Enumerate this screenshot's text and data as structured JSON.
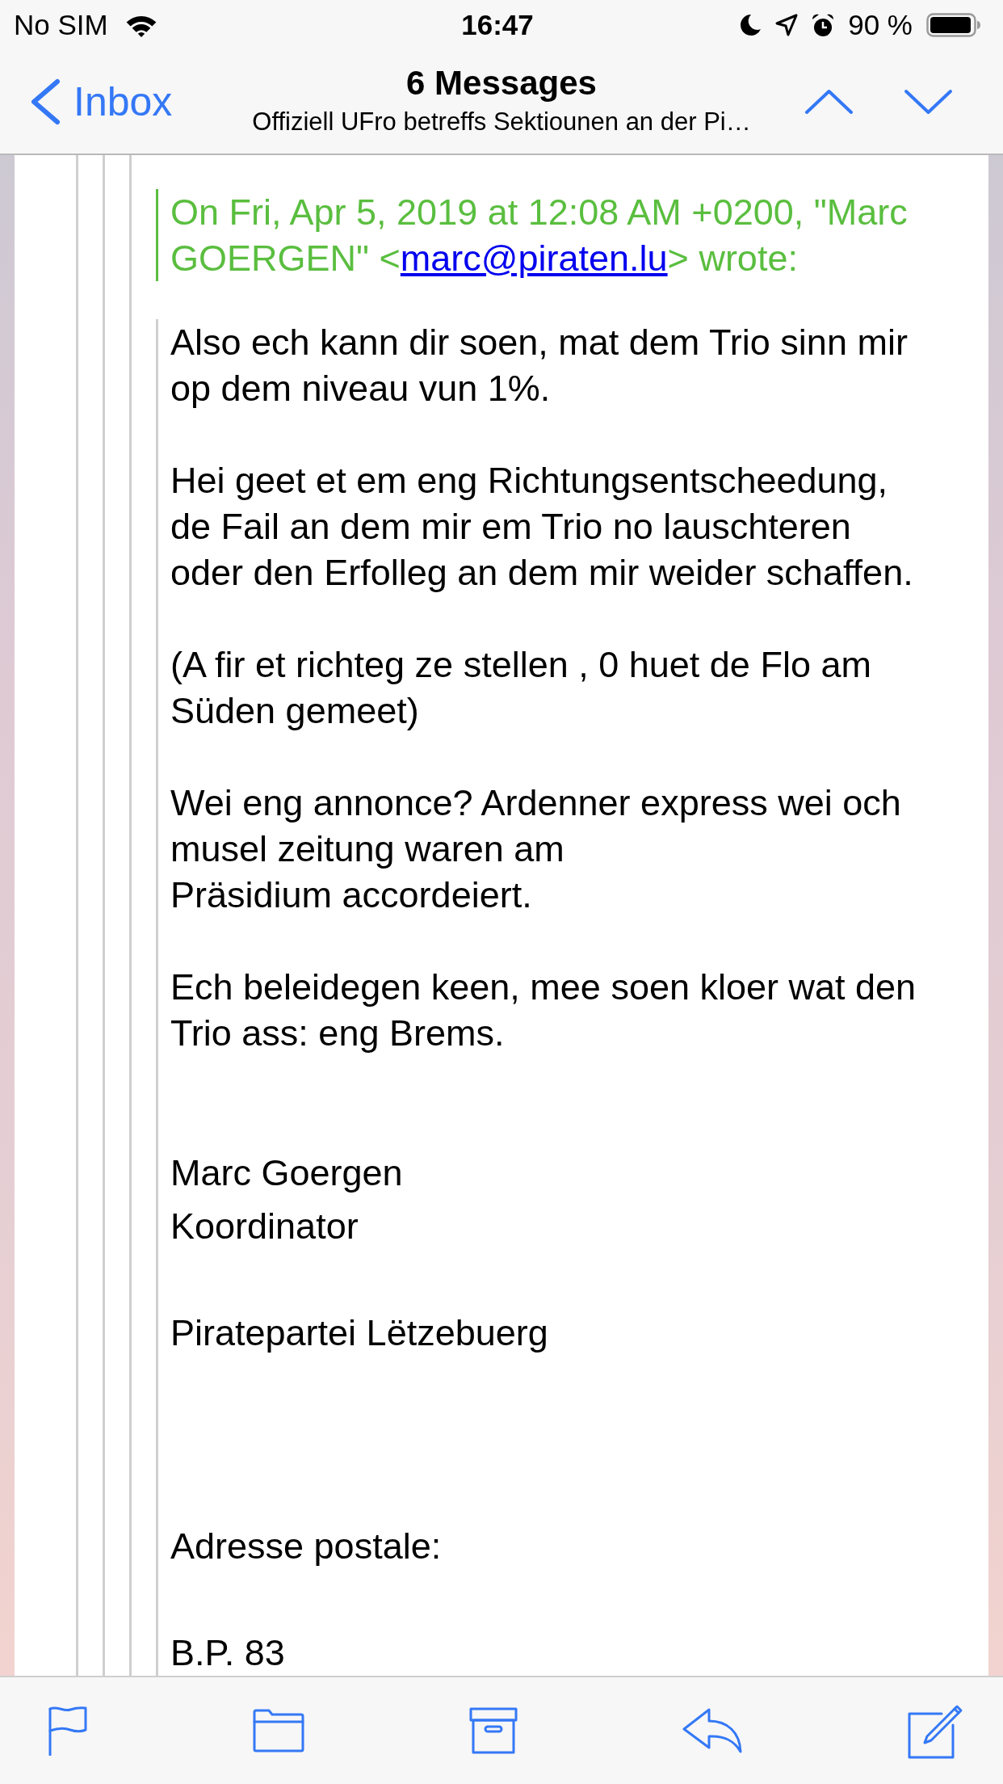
{
  "status_bar": {
    "carrier": "No SIM",
    "time": "16:47",
    "battery_percent": "90 %"
  },
  "nav_bar": {
    "back_label": "Inbox",
    "title": "6 Messages",
    "subtitle": "Offiziell UFro betreffs Sektiounen an der Pi…"
  },
  "message": {
    "attribution": {
      "before": "On Fri, Apr 5, 2019 at 12:08 AM +0200, \"Marc GOERGEN\" <",
      "link": "marc@piraten.lu",
      "after": "> wrote:"
    },
    "paragraphs": [
      {
        "lines": [
          "Also ech kann dir soen, mat dem Trio sinn mir",
          "op dem niveau vun 1%."
        ]
      },
      {
        "lines": [
          "Hei geet et em eng Richtungsentscheedung,",
          "de Fail an dem mir em Trio no lauschteren",
          "oder den Erfolleg an dem mir weider schaffen."
        ]
      },
      {
        "lines": [
          "(A fir et richteg ze stellen , 0 huet de Flo am",
          "Süden gemeet)"
        ]
      },
      {
        "lines": [
          "Wei eng annonce? Ardenner express wei och",
          "musel zeitung waren am",
          "Präsidium accordeiert."
        ]
      },
      {
        "lines": [
          "Ech beleidegen keen, mee soen kloer wat den",
          "Trio ass: eng Brems."
        ]
      }
    ],
    "signature": [
      "Marc Goergen",
      "Koordinator",
      "Piratepartei Lëtzebuerg",
      "Adresse postale:",
      "B.P. 83"
    ]
  }
}
